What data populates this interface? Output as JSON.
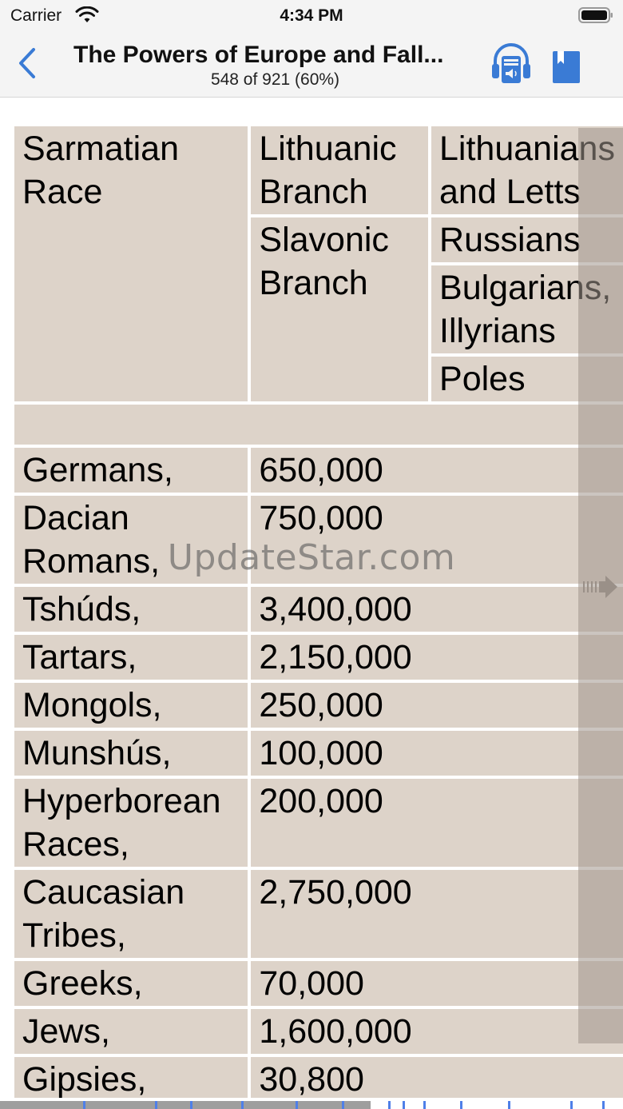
{
  "status_bar": {
    "carrier": "Carrier",
    "time": "4:34 PM"
  },
  "nav": {
    "title": "The Powers of Europe and Fall...",
    "progress_text": "548 of 921 (60%)"
  },
  "colors": {
    "accent": "#3a7bd5",
    "cell_bg": "#ddd3c9"
  },
  "table": {
    "header_rows": [
      [
        "Sarmatian Race",
        "Lithuanic Branch",
        "Lithuanians and Letts"
      ],
      [
        "",
        "Slavonic Branch",
        "Russians"
      ],
      [
        "",
        "",
        "Bulgarians, Illyrians"
      ],
      [
        "",
        "",
        "Poles"
      ]
    ],
    "rows": [
      {
        "name": "Germans,",
        "value": "650,000"
      },
      {
        "name": "Dacian Romans,",
        "value": "750,000"
      },
      {
        "name": "Tshúds,",
        "value": "3,400,000"
      },
      {
        "name": "Tartars,",
        "value": "2,150,000"
      },
      {
        "name": "Mongols,",
        "value": "250,000"
      },
      {
        "name": "Munshús,",
        "value": "100,000"
      },
      {
        "name": "Hyperborean Races,",
        "value": "200,000"
      },
      {
        "name": "Caucasian Tribes,",
        "value": "2,750,000"
      },
      {
        "name": "Greeks,",
        "value": "70,000"
      },
      {
        "name": "Jews,",
        "value": "1,600,000"
      },
      {
        "name": "Gipsies,",
        "value": "30,800"
      }
    ]
  },
  "watermark": "UpdateStar.com",
  "reading_progress": {
    "fraction": 0.595
  }
}
